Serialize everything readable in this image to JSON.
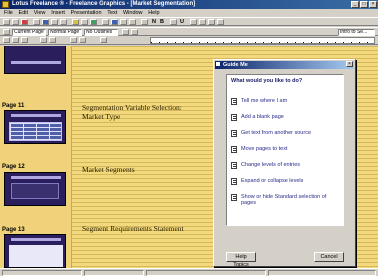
{
  "window": {
    "title": "Lotus Freelance ® - Freelance Graphics - [Market Segmentation]",
    "minimize_glyph": "_",
    "maximize_glyph": "□",
    "close_glyph": "×"
  },
  "menu": {
    "items": [
      "File",
      "Edit",
      "View",
      "Insert",
      "Presentation",
      "Text",
      "Window",
      "Help"
    ]
  },
  "toolbar2": {
    "style_value": "Current Page",
    "font_value": "Normal Page",
    "size_value": "No Outlines",
    "search_value": "Intro to Se..."
  },
  "outline": {
    "pages": [
      {
        "label": "Page 11",
        "text": "Segmentation Variable Selection:\nMarket Type"
      },
      {
        "label": "Page 12",
        "text": "Market Segments"
      },
      {
        "label": "Page 13",
        "text": "Segment Requirements Statement"
      }
    ]
  },
  "dialog": {
    "title": "Guide Me",
    "question": "What would you like to do?",
    "options": [
      "Tell me where I am",
      "Add a blank page",
      "Get text from another source",
      "Move pages to text",
      "Change levels of entries",
      "Expand or collapse levels",
      "Show or hide Standard selection of pages"
    ],
    "help_label": "Help Topics",
    "cancel_label": "Cancel",
    "close_glyph": "×"
  },
  "colors": {
    "title_bar": "#0a246a",
    "workspace": "#f2d97e",
    "thumbnail": "#2a1f5c",
    "dialog": "#d4d0c8"
  }
}
